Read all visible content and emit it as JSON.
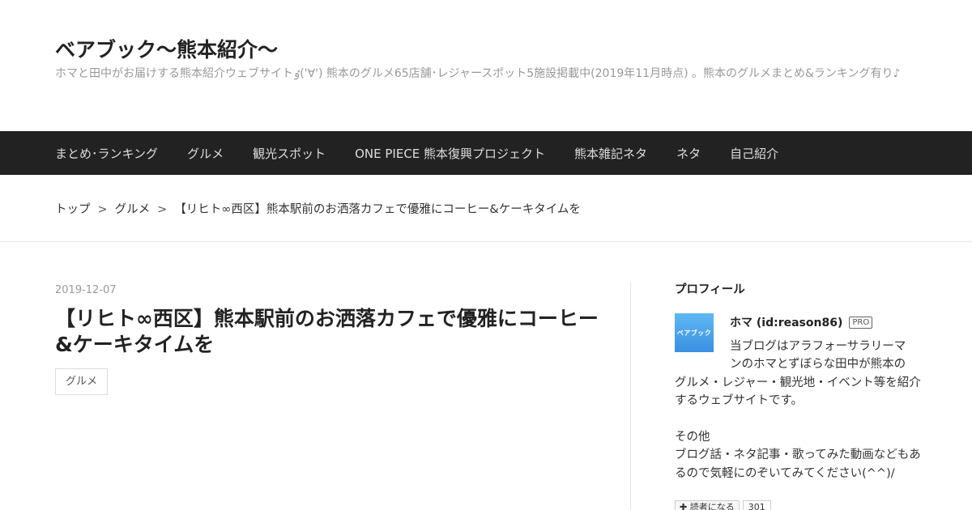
{
  "header": {
    "title": "ベアブック～熊本紹介～",
    "description": "ホマと田中がお届けする熊本紹介ウェブサイトٶ('∀') 熊本のグルメ65店舗･レジャースポット5施設掲載中(2019年11月時点) 。熊本のグルメまとめ&ランキング有り♪"
  },
  "nav": {
    "items": [
      "まとめ･ランキング",
      "グルメ",
      "観光スポット",
      "ONE PIECE 熊本復興プロジェクト",
      "熊本雑記ネタ",
      "ネタ",
      "自己紹介"
    ]
  },
  "breadcrumb": {
    "top": "トップ",
    "separator": ">",
    "category": "グルメ",
    "current": "【リヒト∞西区】熊本駅前のお洒落カフェで優雅にコーヒー&ケーキタイムを"
  },
  "entry": {
    "date": "2019-12-07",
    "title": "【リヒト∞西区】熊本駅前のお洒落カフェで優雅にコーヒー&ケーキタイムを",
    "category": "グルメ"
  },
  "sidebar": {
    "heading": "プロフィール",
    "icon_text": "ベアブック",
    "name": "ホマ (id:reason86)",
    "badge": "PRO",
    "text_line1": "当ブログはアラフォーサラリーマ",
    "text_line2": "ンのホマとずぼらな田中が熊本の",
    "text_rest": "グルメ・レジャー・観光地・イベント等を紹介するウェブサイトです。",
    "text_p2_line1": "その他",
    "text_p2_line2": "ブログ話・ネタ記事・歌ってみた動画などもあるので気軽にのぞいてみてください(^^)/",
    "reader_button": "✚ 読者になる",
    "reader_count": "301"
  }
}
